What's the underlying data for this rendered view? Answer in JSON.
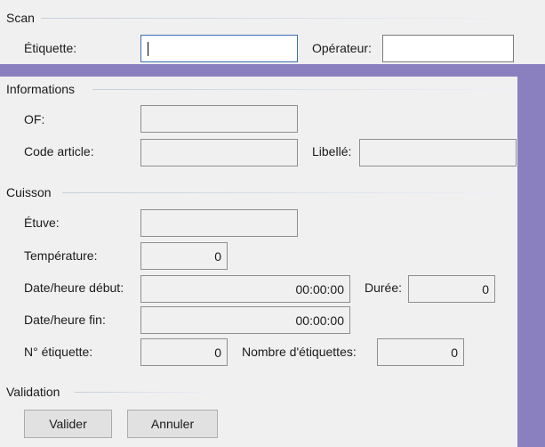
{
  "scan": {
    "title": "Scan",
    "etiquette_label": "Étiquette:",
    "etiquette_value": "",
    "operateur_label": "Opérateur:",
    "operateur_value": ""
  },
  "informations": {
    "title": "Informations",
    "of_label": "OF:",
    "of_value": "",
    "code_article_label": "Code article:",
    "code_article_value": "",
    "libelle_label": "Libellé:",
    "libelle_value": ""
  },
  "cuisson": {
    "title": "Cuisson",
    "etuve_label": "Étuve:",
    "etuve_value": "",
    "temperature_label": "Température:",
    "temperature_value": "0",
    "date_debut_label": "Date/heure début:",
    "date_debut_value": "00:00:00",
    "duree_label": "Durée:",
    "duree_value": "0",
    "date_fin_label": "Date/heure fin:",
    "date_fin_value": "00:00:00",
    "num_etiquette_label": "N° étiquette:",
    "num_etiquette_value": "0",
    "nombre_etiquettes_label": "Nombre d'étiquettes:",
    "nombre_etiquettes_value": "0"
  },
  "validation": {
    "title": "Validation",
    "valider_label": "Valider",
    "annuler_label": "Annuler"
  },
  "colors": {
    "window_background": "#8a80c0",
    "panel_background": "#f0f0f0",
    "focus_border": "#3c70b4"
  }
}
